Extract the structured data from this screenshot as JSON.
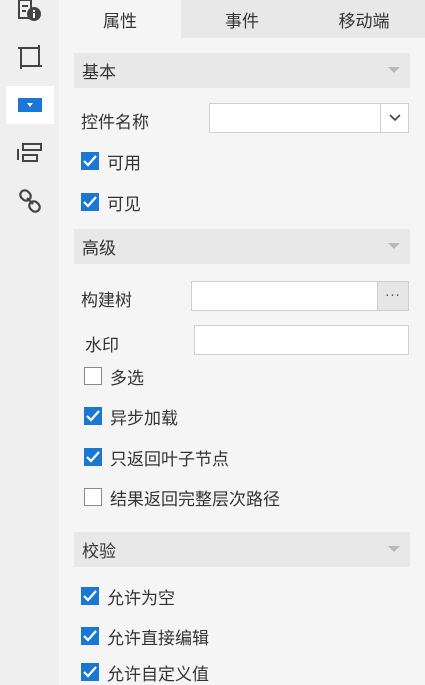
{
  "tabs": [
    {
      "label": "属性",
      "active": true
    },
    {
      "label": "事件",
      "active": false
    },
    {
      "label": "移动端",
      "active": false
    }
  ],
  "rail": [
    {
      "icon": "info-component-icon",
      "active": false
    },
    {
      "icon": "frame-square-icon",
      "active": false
    },
    {
      "icon": "dropdown-widget-icon",
      "active": true
    },
    {
      "icon": "layout-bars-icon",
      "active": false
    },
    {
      "icon": "link-chain-icon",
      "active": false
    }
  ],
  "basic": {
    "title": "基本",
    "widget_name_label": "控件名称",
    "widget_name_value": "",
    "enabled_label": "可用",
    "enabled": true,
    "visible_label": "可见",
    "visible": true
  },
  "advanced": {
    "title": "高级",
    "build_tree_label": "构建树",
    "build_tree_value": "",
    "build_tree_button": "···",
    "watermark_label": "水印",
    "watermark_value": "",
    "multi_select_label": "多选",
    "multi_select": false,
    "async_load_label": "异步加载",
    "async_load": true,
    "leaf_only_label": "只返回叶子节点",
    "leaf_only": true,
    "full_path_label": "结果返回完整层次路径",
    "full_path": false
  },
  "validation": {
    "title": "校验",
    "allow_empty_label": "允许为空",
    "allow_empty": true,
    "allow_direct_edit_label": "允许直接编辑",
    "allow_direct_edit": true,
    "allow_custom_label": "允许自定义值",
    "allow_custom": true
  },
  "colors": {
    "accent": "#1a78d4",
    "rail_bg": "#efefef",
    "panel_bg": "#f5f5f5",
    "header_bg": "#e8e8e8"
  }
}
